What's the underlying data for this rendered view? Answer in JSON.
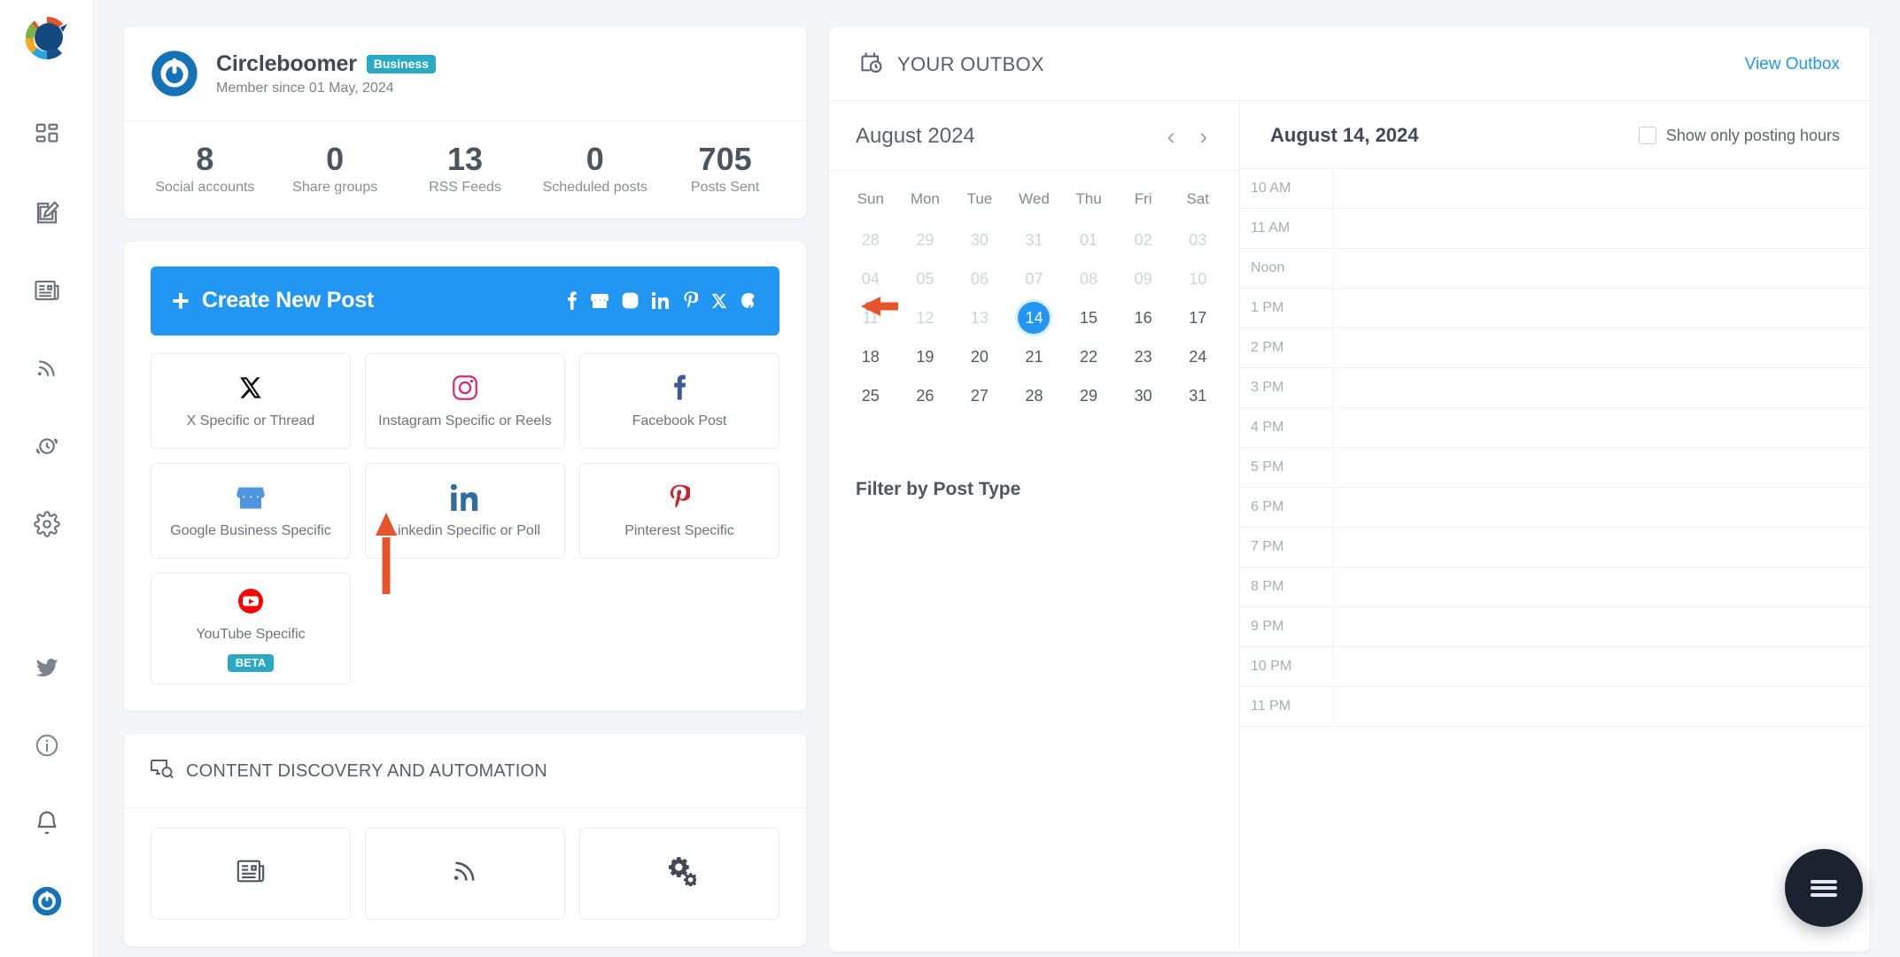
{
  "sidebar": {
    "logo": "circleboom-logo",
    "items": [
      {
        "name": "dashboard",
        "icon": "grid-icon"
      },
      {
        "name": "compose",
        "icon": "edit-square-icon"
      },
      {
        "name": "news",
        "icon": "newspaper-icon"
      },
      {
        "name": "rss",
        "icon": "rss-icon"
      },
      {
        "name": "queue",
        "icon": "clock-refresh-icon"
      },
      {
        "name": "settings",
        "icon": "gear-icon"
      }
    ],
    "bottom_items": [
      {
        "name": "twitter",
        "icon": "twitter-bird-icon"
      },
      {
        "name": "info",
        "icon": "info-circle-icon"
      },
      {
        "name": "notifications",
        "icon": "bell-icon"
      },
      {
        "name": "account",
        "icon": "circleboom-avatar-icon"
      }
    ]
  },
  "profile": {
    "name": "Circleboomer",
    "plan_badge": "Business",
    "member_since": "Member since 01 May, 2024",
    "avatar": "circleboom-avatar-icon"
  },
  "stats": [
    {
      "value": "8",
      "label": "Social accounts"
    },
    {
      "value": "0",
      "label": "Share groups"
    },
    {
      "value": "13",
      "label": "RSS Feeds"
    },
    {
      "value": "0",
      "label": "Scheduled posts"
    },
    {
      "value": "705",
      "label": "Posts Sent"
    }
  ],
  "create_post": {
    "label": "Create New Post",
    "plus": "+",
    "network_icons": [
      "facebook-icon",
      "google-business-icon",
      "instagram-icon",
      "linkedin-icon",
      "pinterest-icon",
      "x-icon",
      "threads-icon"
    ],
    "accent_color": "#2196f3"
  },
  "post_types": [
    {
      "label": "X Specific or Thread",
      "icon": "x-icon"
    },
    {
      "label": "Instagram Specific or Reels",
      "icon": "instagram-icon"
    },
    {
      "label": "Facebook Post",
      "icon": "facebook-icon"
    },
    {
      "label": "Google Business Specific",
      "icon": "google-business-icon"
    },
    {
      "label": "Linkedin Specific or Poll",
      "icon": "linkedin-icon"
    },
    {
      "label": "Pinterest Specific",
      "icon": "pinterest-icon"
    },
    {
      "label": "YouTube Specific",
      "icon": "youtube-icon",
      "badge": "BETA"
    }
  ],
  "content_discovery": {
    "title": "CONTENT DISCOVERY AND AUTOMATION",
    "icon": "content-search-icon",
    "cards": [
      {
        "icon": "newspaper-icon"
      },
      {
        "icon": "rss-icon"
      },
      {
        "icon": "gears-icon"
      }
    ]
  },
  "outbox": {
    "title": "YOUR OUTBOX",
    "icon": "calendar-clock-icon",
    "view_link": "View Outbox",
    "calendar": {
      "month_label": "August 2024",
      "prev": "‹",
      "next": "›",
      "dow": [
        "Sun",
        "Mon",
        "Tue",
        "Wed",
        "Thu",
        "Fri",
        "Sat"
      ],
      "selected_day": "14",
      "weeks": [
        [
          {
            "d": "28",
            "muted": true
          },
          {
            "d": "29",
            "muted": true
          },
          {
            "d": "30",
            "muted": true
          },
          {
            "d": "31",
            "muted": true
          },
          {
            "d": "01",
            "muted": true
          },
          {
            "d": "02",
            "muted": true
          },
          {
            "d": "03",
            "muted": true
          }
        ],
        [
          {
            "d": "04",
            "muted": true
          },
          {
            "d": "05",
            "muted": true
          },
          {
            "d": "06",
            "muted": true
          },
          {
            "d": "07",
            "muted": true
          },
          {
            "d": "08",
            "muted": true
          },
          {
            "d": "09",
            "muted": true
          },
          {
            "d": "10",
            "muted": true
          }
        ],
        [
          {
            "d": "11",
            "muted": true
          },
          {
            "d": "12",
            "muted": true
          },
          {
            "d": "13",
            "muted": true
          },
          {
            "d": "14",
            "selected": true
          },
          {
            "d": "15"
          },
          {
            "d": "16"
          },
          {
            "d": "17"
          }
        ],
        [
          {
            "d": "18"
          },
          {
            "d": "19"
          },
          {
            "d": "20"
          },
          {
            "d": "21"
          },
          {
            "d": "22"
          },
          {
            "d": "23"
          },
          {
            "d": "24"
          }
        ],
        [
          {
            "d": "25"
          },
          {
            "d": "26"
          },
          {
            "d": "27"
          },
          {
            "d": "28"
          },
          {
            "d": "29"
          },
          {
            "d": "30"
          },
          {
            "d": "31"
          }
        ]
      ]
    },
    "filter_title": "Filter by Post Type",
    "schedule": {
      "date_label": "August 14, 2024",
      "checkbox_label": "Show only posting hours",
      "checkbox_checked": false,
      "slots": [
        "10 AM",
        "11 AM",
        "Noon",
        "1 PM",
        "2 PM",
        "3 PM",
        "4 PM",
        "5 PM",
        "6 PM",
        "7 PM",
        "8 PM",
        "9 PM",
        "10 PM",
        "11 PM"
      ]
    }
  },
  "annotations": {
    "arrow_color": "#e8542a",
    "arrow_left": "arrow-left-annotation",
    "arrow_up": "arrow-up-annotation"
  },
  "fab": {
    "icon": "hamburger-menu-icon",
    "color": "#1b2330"
  }
}
